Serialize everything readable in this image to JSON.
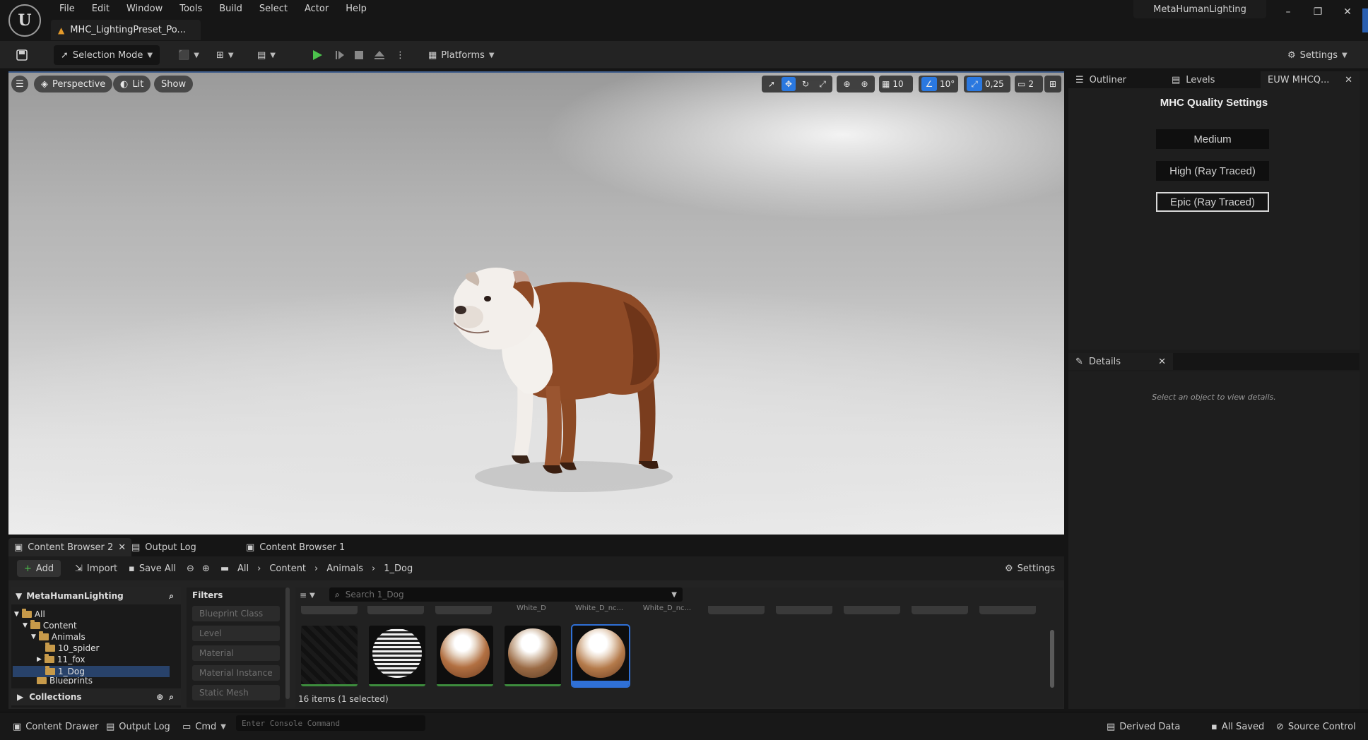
{
  "menu": [
    "File",
    "Edit",
    "Window",
    "Tools",
    "Build",
    "Select",
    "Actor",
    "Help"
  ],
  "document_tab": "MHC_LightingPreset_Po...",
  "project_name": "MetaHumanLighting",
  "toolbar": {
    "mode": "Selection Mode",
    "platforms": "Platforms",
    "settings": "Settings"
  },
  "viewport": {
    "perspective": "Perspective",
    "lit": "Lit",
    "show": "Show",
    "grid_snap": "10",
    "rotation_snap": "10°",
    "scale_snap": "0,25",
    "camera_speed": "2"
  },
  "right_tabs": {
    "outliner": "Outliner",
    "levels": "Levels",
    "euw": "EUW MHCQ..."
  },
  "quality": {
    "title": "MHC Quality Settings",
    "options": [
      "Medium",
      "High (Ray Traced)",
      "Epic (Ray Traced)"
    ],
    "selected_index": 2
  },
  "details": {
    "tab": "Details",
    "hint": "Select an object to view details."
  },
  "content_browser": {
    "tabs": [
      "Content Browser 2",
      "Output Log",
      "Content Browser 1"
    ],
    "add": "Add",
    "import": "Import",
    "save_all": "Save All",
    "breadcrumb": [
      "All",
      "Content",
      "Animals",
      "1_Dog"
    ],
    "settings": "Settings",
    "tree_root": "MetaHumanLighting",
    "tree": [
      "All",
      "Content",
      "Animals",
      "10_spider",
      "11_fox",
      "1_Dog",
      "Blueprints"
    ],
    "collections": "Collections",
    "filters_title": "Filters",
    "filters": [
      "Blueprint Class",
      "Level",
      "Material",
      "Material Instance",
      "Static Mesh"
    ],
    "search_placeholder": "Search 1_Dog",
    "top_row_names": [
      "",
      "",
      "",
      "White_D",
      "White_D_nc...",
      "White_D_nc...",
      "",
      "",
      "",
      "",
      ""
    ],
    "item_count": "16 items (1 selected)"
  },
  "statusbar": {
    "content_drawer": "Content Drawer",
    "output_log": "Output Log",
    "cmd": "Cmd",
    "console_placeholder": "Enter Console Command",
    "derived_data": "Derived Data",
    "all_saved": "All Saved",
    "source_control": "Source Control"
  },
  "colors": {
    "accent": "#2a78e0",
    "selection": "#28426a",
    "bg": "#1b1b1b"
  }
}
